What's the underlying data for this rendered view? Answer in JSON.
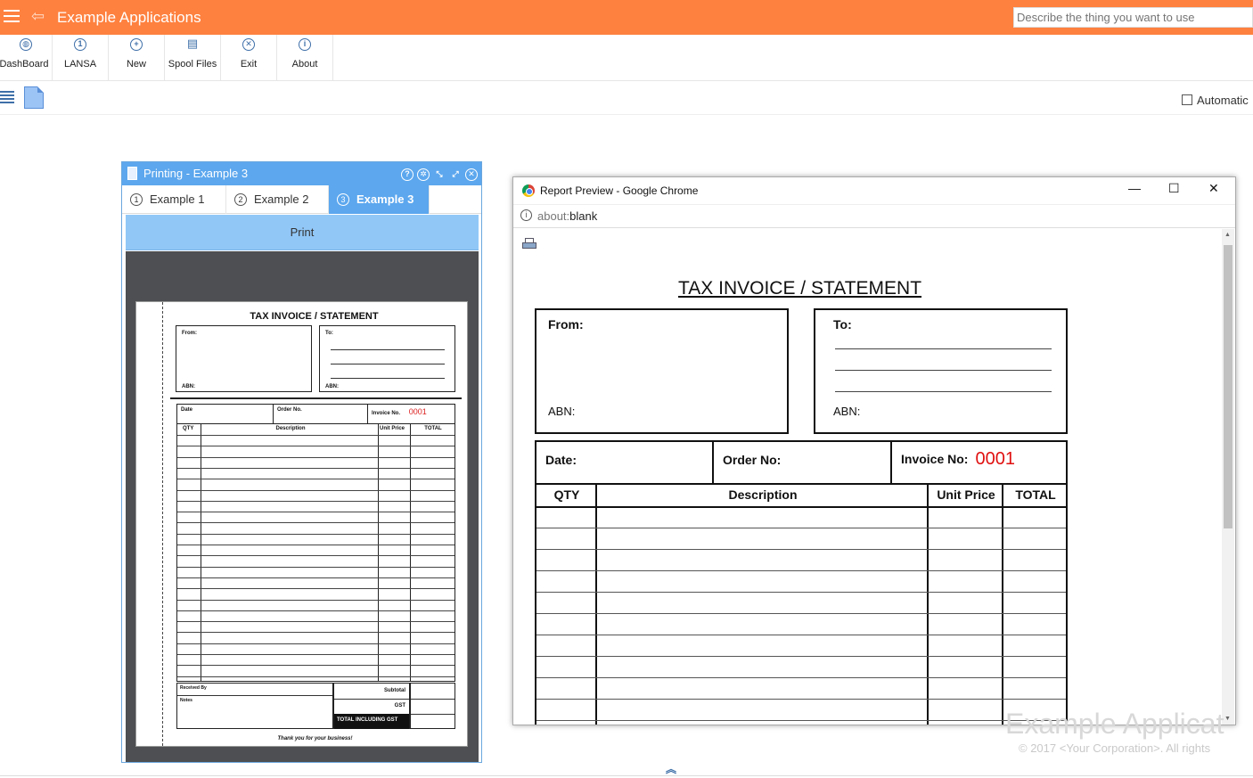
{
  "app": {
    "title": "Example Applications",
    "search_placeholder": "Describe the thing you want to use",
    "accent_color": "#fe813f"
  },
  "toolbar": {
    "items": [
      {
        "label": "DashBoard",
        "icon": "globe-icon",
        "glyph": "◍"
      },
      {
        "label": "LANSA",
        "icon": "number-one-icon",
        "glyph": "1"
      },
      {
        "label": "New",
        "icon": "plus-icon",
        "glyph": "+"
      },
      {
        "label": "Spool Files",
        "icon": "document-icon",
        "glyph": "▤"
      },
      {
        "label": "Exit",
        "icon": "close-icon",
        "glyph": "✕"
      },
      {
        "label": "About",
        "icon": "info-icon",
        "glyph": "i"
      }
    ]
  },
  "subbar": {
    "automatic_label": "Automatic"
  },
  "panel": {
    "title": "Printing - Example 3",
    "tabs": [
      {
        "num": "1",
        "label": "Example 1"
      },
      {
        "num": "2",
        "label": "Example 2"
      },
      {
        "num": "3",
        "label": "Example 3"
      }
    ],
    "print_label": "Print"
  },
  "mini_invoice": {
    "title": "TAX INVOICE / STATEMENT",
    "from": "From:",
    "to": "To:",
    "abn": "ABN:",
    "date": "Date",
    "order": "Order No.",
    "invoice": "Invoice No.",
    "invoice_no": "0001",
    "qty": "QTY",
    "description": "Description",
    "unit_price": "Unit Price",
    "total": "TOTAL",
    "received_by": "Received By",
    "notes": "Notes",
    "subtotal": "Subtotal",
    "gst": "GST",
    "total_incl": "TOTAL INCLUDING GST",
    "thanks": "Thank you for your business!"
  },
  "chrome": {
    "title": "Report Preview - Google Chrome",
    "url_scheme": "about:",
    "url_rest": "blank",
    "minimize": "—",
    "maximize": "☐",
    "close": "✕"
  },
  "invoice": {
    "title": "TAX INVOICE / STATEMENT",
    "from": "From:",
    "to": "To:",
    "abn": "ABN:",
    "date": "Date:",
    "order": "Order No:",
    "invoice": "Invoice No:",
    "invoice_no": "0001",
    "qty": "QTY",
    "description": "Description",
    "unit_price": "Unit Price",
    "total": "TOTAL"
  },
  "footer": {
    "watermark": "Example Applicat",
    "copyright": "© 2017 <Your Corporation>. All rights"
  }
}
